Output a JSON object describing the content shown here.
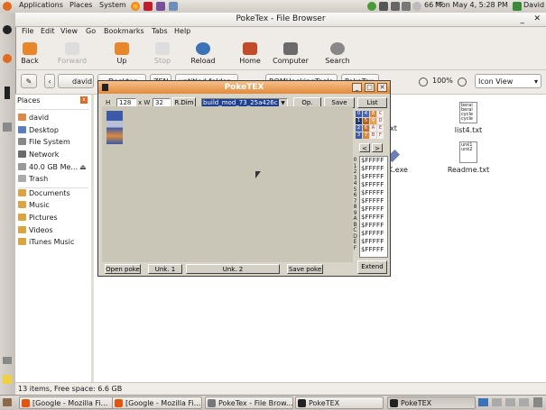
{
  "top_panel": {
    "menus": [
      "Applications",
      "Places",
      "System"
    ],
    "weather": "66 °F",
    "clock": "Mon May  4,  5:28 PM",
    "user": "David"
  },
  "file_browser": {
    "title": "PokeTex - File Browser",
    "menus": [
      "File",
      "Edit",
      "View",
      "Go",
      "Bookmarks",
      "Tabs",
      "Help"
    ],
    "toolbar": [
      {
        "label": "Back",
        "icon": "back-arrow-icon"
      },
      {
        "label": "Forward",
        "icon": "forward-arrow-icon"
      },
      {
        "label": "Up",
        "icon": "up-arrow-icon"
      },
      {
        "label": "Stop",
        "icon": "stop-icon"
      },
      {
        "label": "Reload",
        "icon": "reload-icon"
      },
      {
        "label": "Home",
        "icon": "home-icon"
      },
      {
        "label": "Computer",
        "icon": "computer-icon"
      },
      {
        "label": "Search",
        "icon": "search-icon"
      }
    ],
    "breadcrumbs": [
      "david",
      "Desktop",
      "ZEN",
      "untitled folder",
      "ROMHackingTools",
      "PokeTex"
    ],
    "zoom": "100%",
    "view_mode": "Icon View",
    "sidebar_title": "Places",
    "places": [
      "david",
      "Desktop",
      "File System",
      "Network",
      "40.0 GB Me...",
      "Trash",
      "Documents",
      "Music",
      "Pictures",
      "Videos",
      "iTunes Music"
    ],
    "files": [
      {
        "name": "list4.txt",
        "content": "berai\nberai\ncycle\ncycle"
      },
      {
        "name": "Readme.txt",
        "content": "unk1\nunk2"
      }
    ],
    "partial_labels": [
      "xt",
      "K.exe"
    ],
    "status": "13 items, Free space: 6.6 GB"
  },
  "poketex": {
    "title": "PokeTEX",
    "h_label": "H",
    "h_value": "128",
    "w_label": "x W",
    "w_value": "32",
    "rdim_label": "R.Dim",
    "rom_file": "build_mod_73_25a426c",
    "op_rom_label": "Op. ROM",
    "save_bmp_label": "Save bmp",
    "list_refresh_label": "List Rfrsh",
    "palette_letters": [
      "0",
      "4",
      "8",
      "C",
      "1",
      "5",
      "9",
      "D",
      "2",
      "6",
      "A",
      "E",
      "3",
      "7",
      "B",
      "F"
    ],
    "row_labels": [
      "0",
      "1",
      "2",
      "3",
      "4",
      "5",
      "6",
      "7",
      "8",
      "9",
      "A",
      "B",
      "C",
      "D",
      "E",
      "F"
    ],
    "hex_values": [
      "$FFFFF",
      "$FFFFF",
      "$FFFFF",
      "$FFFFF",
      "$FFFFF",
      "$FFFFF",
      "$FFFFF",
      "$FFFFF",
      "$FFFFF",
      "$FFFFF",
      "$FFFFF",
      "$FFFFF"
    ],
    "open_poke_label": "Open poke",
    "unk1_label": "Unk. 1",
    "unk2_label": "Unk. 2",
    "save_poke_label": "Save poke",
    "extend_label": "Extend"
  },
  "taskbar": [
    {
      "label": "[Google - Mozilla Fi..."
    },
    {
      "label": "[Google - Mozilla Fi..."
    },
    {
      "label": "PokeTex - File Brow..."
    },
    {
      "label": "PokeTEX"
    },
    {
      "label": "PokeTEX"
    }
  ],
  "colors": {
    "accent": "#e08a3c",
    "desktop_bg": "#efebe7"
  }
}
